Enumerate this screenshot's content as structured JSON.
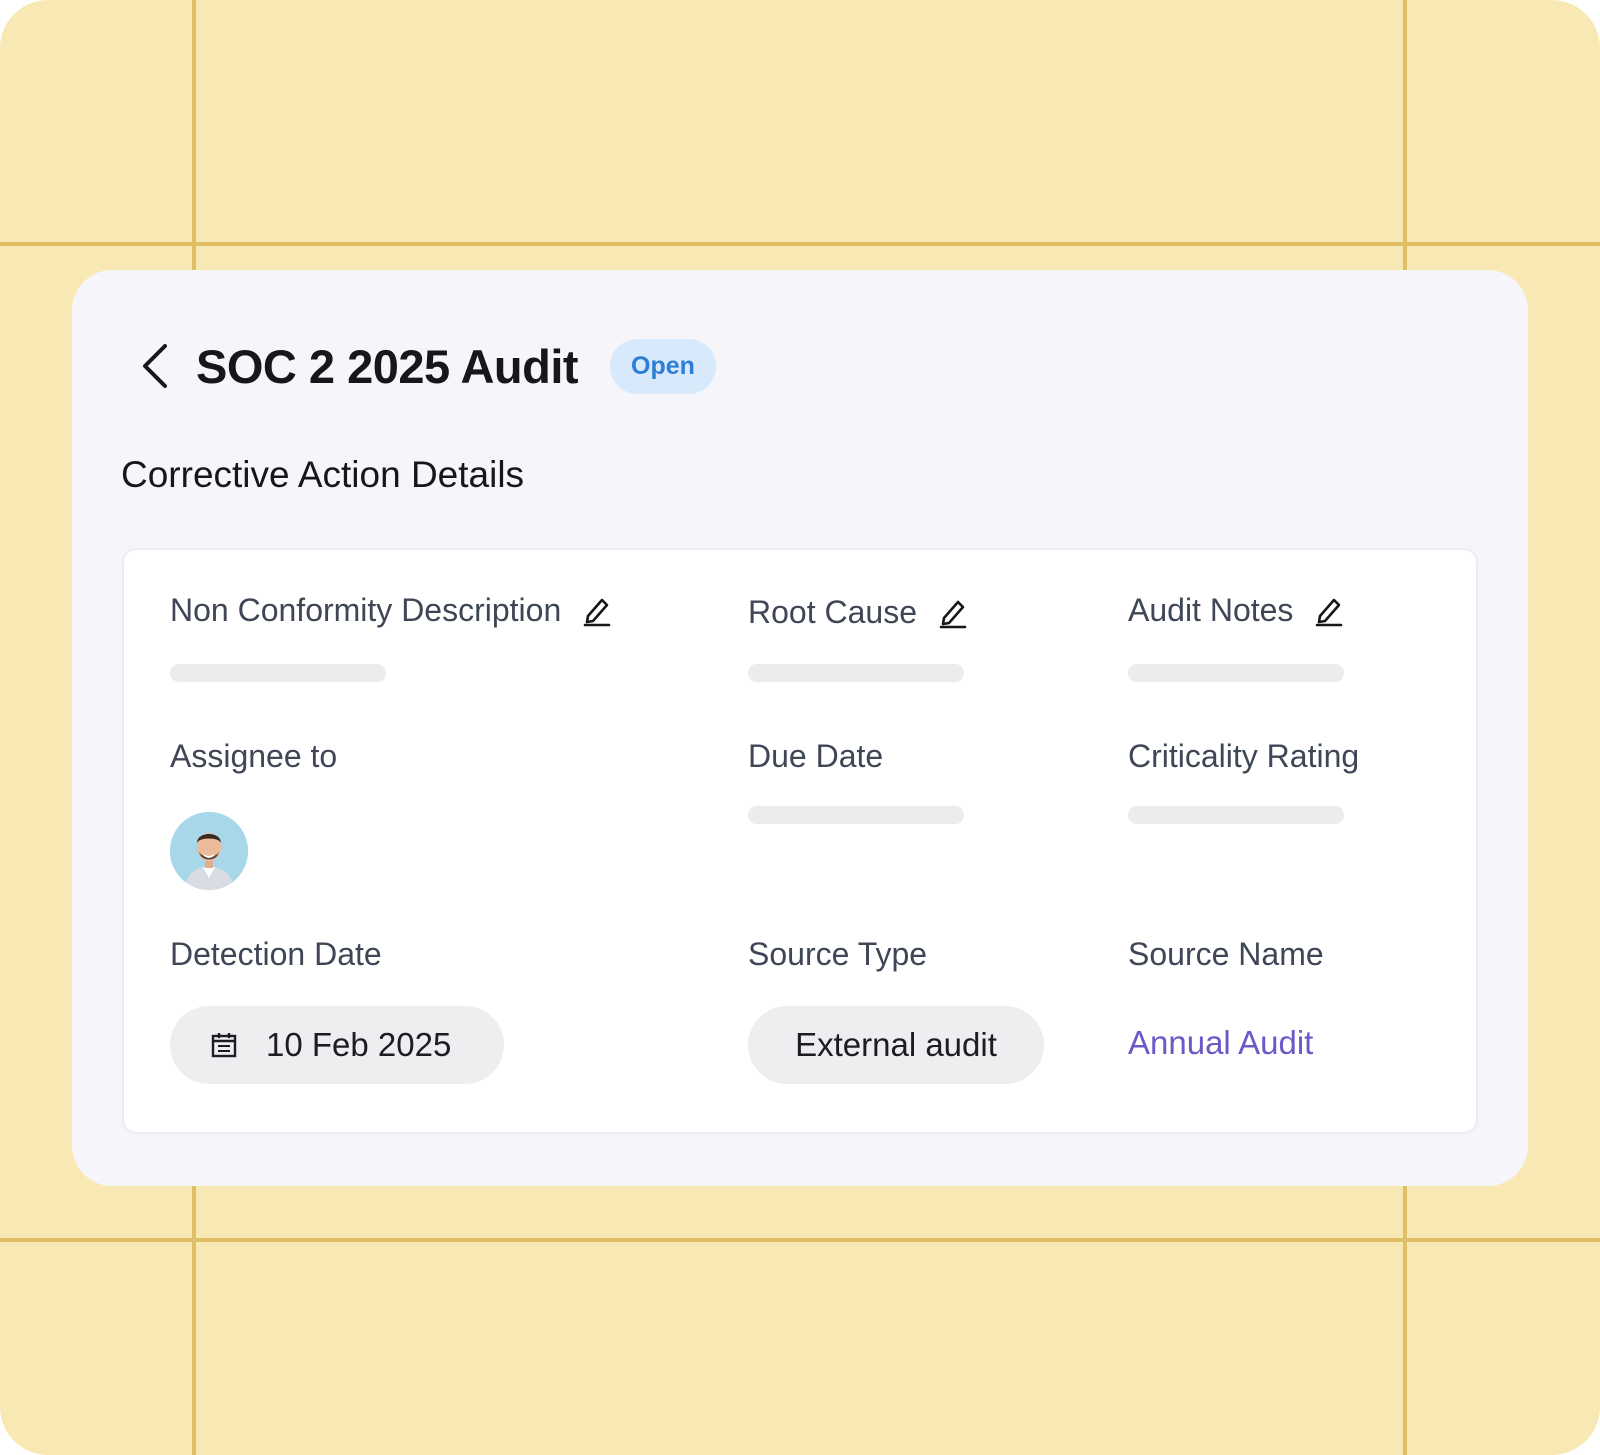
{
  "header": {
    "title": "SOC 2 2025 Audit",
    "status": "Open",
    "back_icon": "chevron-left-icon"
  },
  "section": {
    "title": "Corrective Action Details"
  },
  "fields": {
    "non_conformity": {
      "label": "Non Conformity Description",
      "editable": true
    },
    "root_cause": {
      "label": "Root Cause",
      "editable": true
    },
    "audit_notes": {
      "label": "Audit Notes",
      "editable": true
    },
    "assignee": {
      "label": "Assignee to"
    },
    "due_date": {
      "label": "Due Date"
    },
    "criticality": {
      "label": "Criticality Rating"
    },
    "detection_date": {
      "label": "Detection Date",
      "value": "10 Feb 2025",
      "icon": "calendar-icon"
    },
    "source_type": {
      "label": "Source Type",
      "value": "External audit"
    },
    "source_name": {
      "label": "Source Name",
      "value": "Annual Audit"
    }
  },
  "colors": {
    "background": "#F8E8B4",
    "grid_line": "#E2BE62",
    "panel": "#F5F5FA",
    "badge_bg": "#D7E9FB",
    "badge_text": "#2C7ED6",
    "link": "#6A5AC8"
  }
}
